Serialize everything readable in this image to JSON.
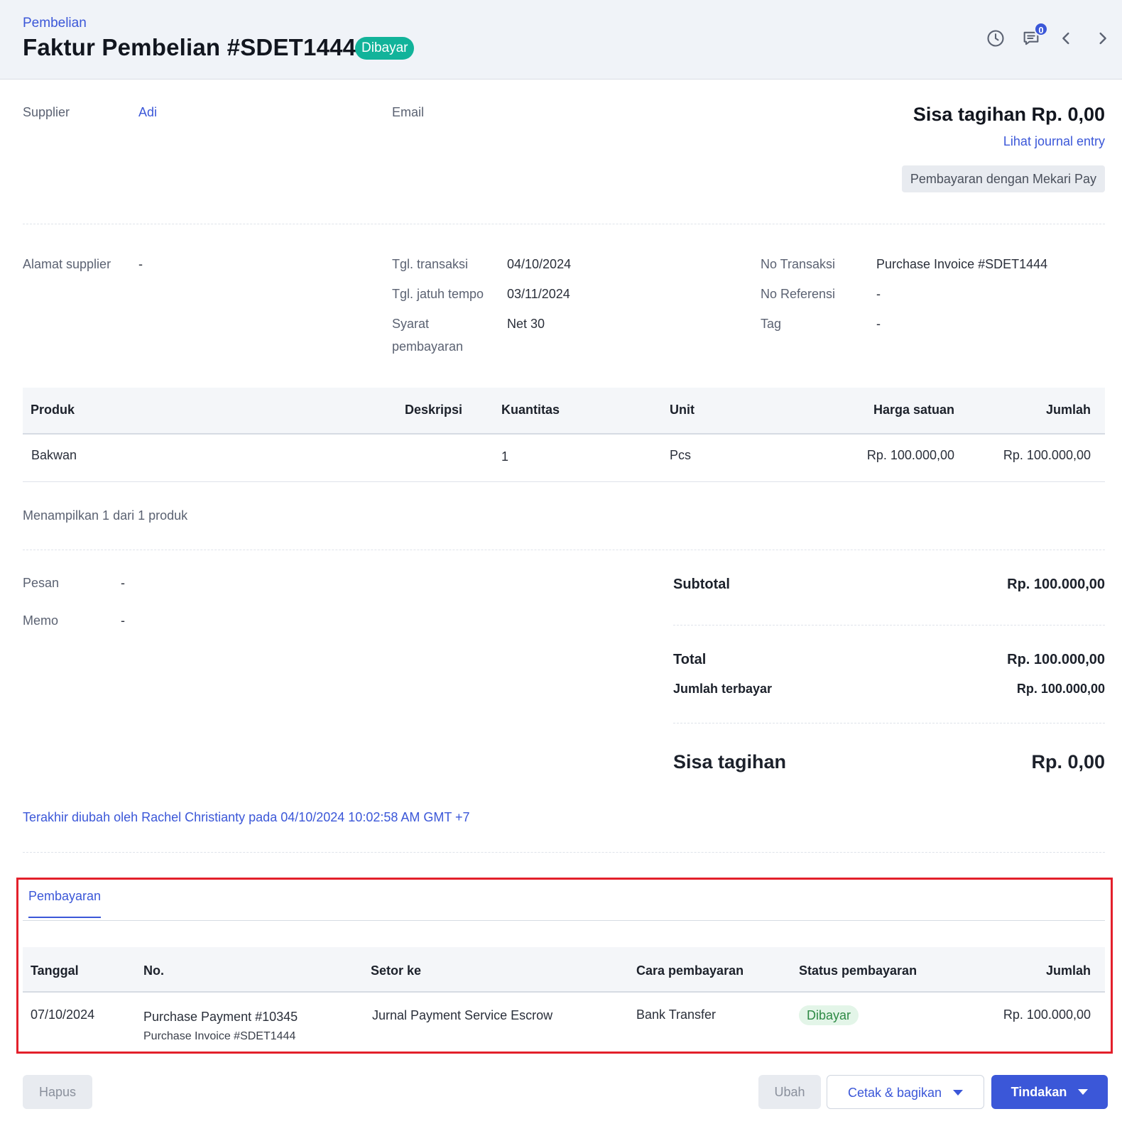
{
  "header": {
    "breadcrumb": "Pembelian",
    "title": "Faktur Pembelian #SDET1444",
    "status_badge": "Dibayar",
    "notification_count": "0",
    "icons": [
      "history-icon",
      "comment-icon",
      "chevron-left-icon",
      "chevron-right-icon"
    ]
  },
  "supplier": {
    "label": "Supplier",
    "value": "Adi"
  },
  "email": {
    "label": "Email",
    "value": ""
  },
  "balance": {
    "heading": "Sisa tagihan Rp. 0,00",
    "journal_link": "Lihat journal entry",
    "mekari_button": "Pembayaran dengan Mekari Pay"
  },
  "address": {
    "label": "Alamat supplier",
    "value": "-"
  },
  "dates": {
    "transaction_date_label": "Tgl. transaksi",
    "transaction_date": "04/10/2024",
    "due_date_label": "Tgl. jatuh tempo",
    "due_date": "03/11/2024",
    "terms_label_line1": "Syarat",
    "terms_label_line2": "pembayaran",
    "terms": "Net 30"
  },
  "transaction": {
    "no_label": "No Transaksi",
    "no_value": "Purchase Invoice #SDET1444",
    "ref_label": "No Referensi",
    "ref_value": "-",
    "tag_label": "Tag",
    "tag_value": "-"
  },
  "products": {
    "columns": [
      "Produk",
      "Deskripsi",
      "Kuantitas",
      "Unit",
      "Harga satuan",
      "Jumlah"
    ],
    "rows": [
      {
        "product": "Bakwan",
        "description": "",
        "quantity": "1",
        "unit": "Pcs",
        "price": "Rp. 100.000,00",
        "amount": "Rp. 100.000,00"
      }
    ],
    "footer": "Menampilkan 1 dari 1 produk"
  },
  "notes": {
    "message_label": "Pesan",
    "message_value": "-",
    "memo_label": "Memo",
    "memo_value": "-"
  },
  "totals": {
    "subtotal_label": "Subtotal",
    "subtotal": "Rp. 100.000,00",
    "total_label": "Total",
    "total": "Rp. 100.000,00",
    "paid_label": "Jumlah terbayar",
    "paid": "Rp. 100.000,00",
    "balance_label": "Sisa tagihan",
    "balance": "Rp. 0,00"
  },
  "last_modified": "Terakhir diubah oleh Rachel Christianty pada 04/10/2024 10:02:58 AM GMT +7",
  "payments": {
    "tab": "Pembayaran",
    "columns": [
      "Tanggal",
      "No.",
      "Setor ke",
      "Cara pembayaran",
      "Status pembayaran",
      "Jumlah"
    ],
    "rows": [
      {
        "date": "07/10/2024",
        "number": "Purchase Payment #10345",
        "sub_number": "Purchase Invoice #SDET1444",
        "deposit_to": "Jurnal Payment Service Escrow",
        "method": "Bank Transfer",
        "status": "Dibayar",
        "amount": "Rp. 100.000,00"
      }
    ]
  },
  "actions": {
    "delete": "Hapus",
    "edit": "Ubah",
    "print_share": "Cetak & bagikan",
    "actions": "Tindakan"
  },
  "colors": {
    "accent": "#3b57d8",
    "paid_badge": "#12b39a",
    "highlight_border": "#e3202b",
    "status_paid_bg": "#e3f5e8",
    "status_paid_text": "#2e8a45"
  }
}
